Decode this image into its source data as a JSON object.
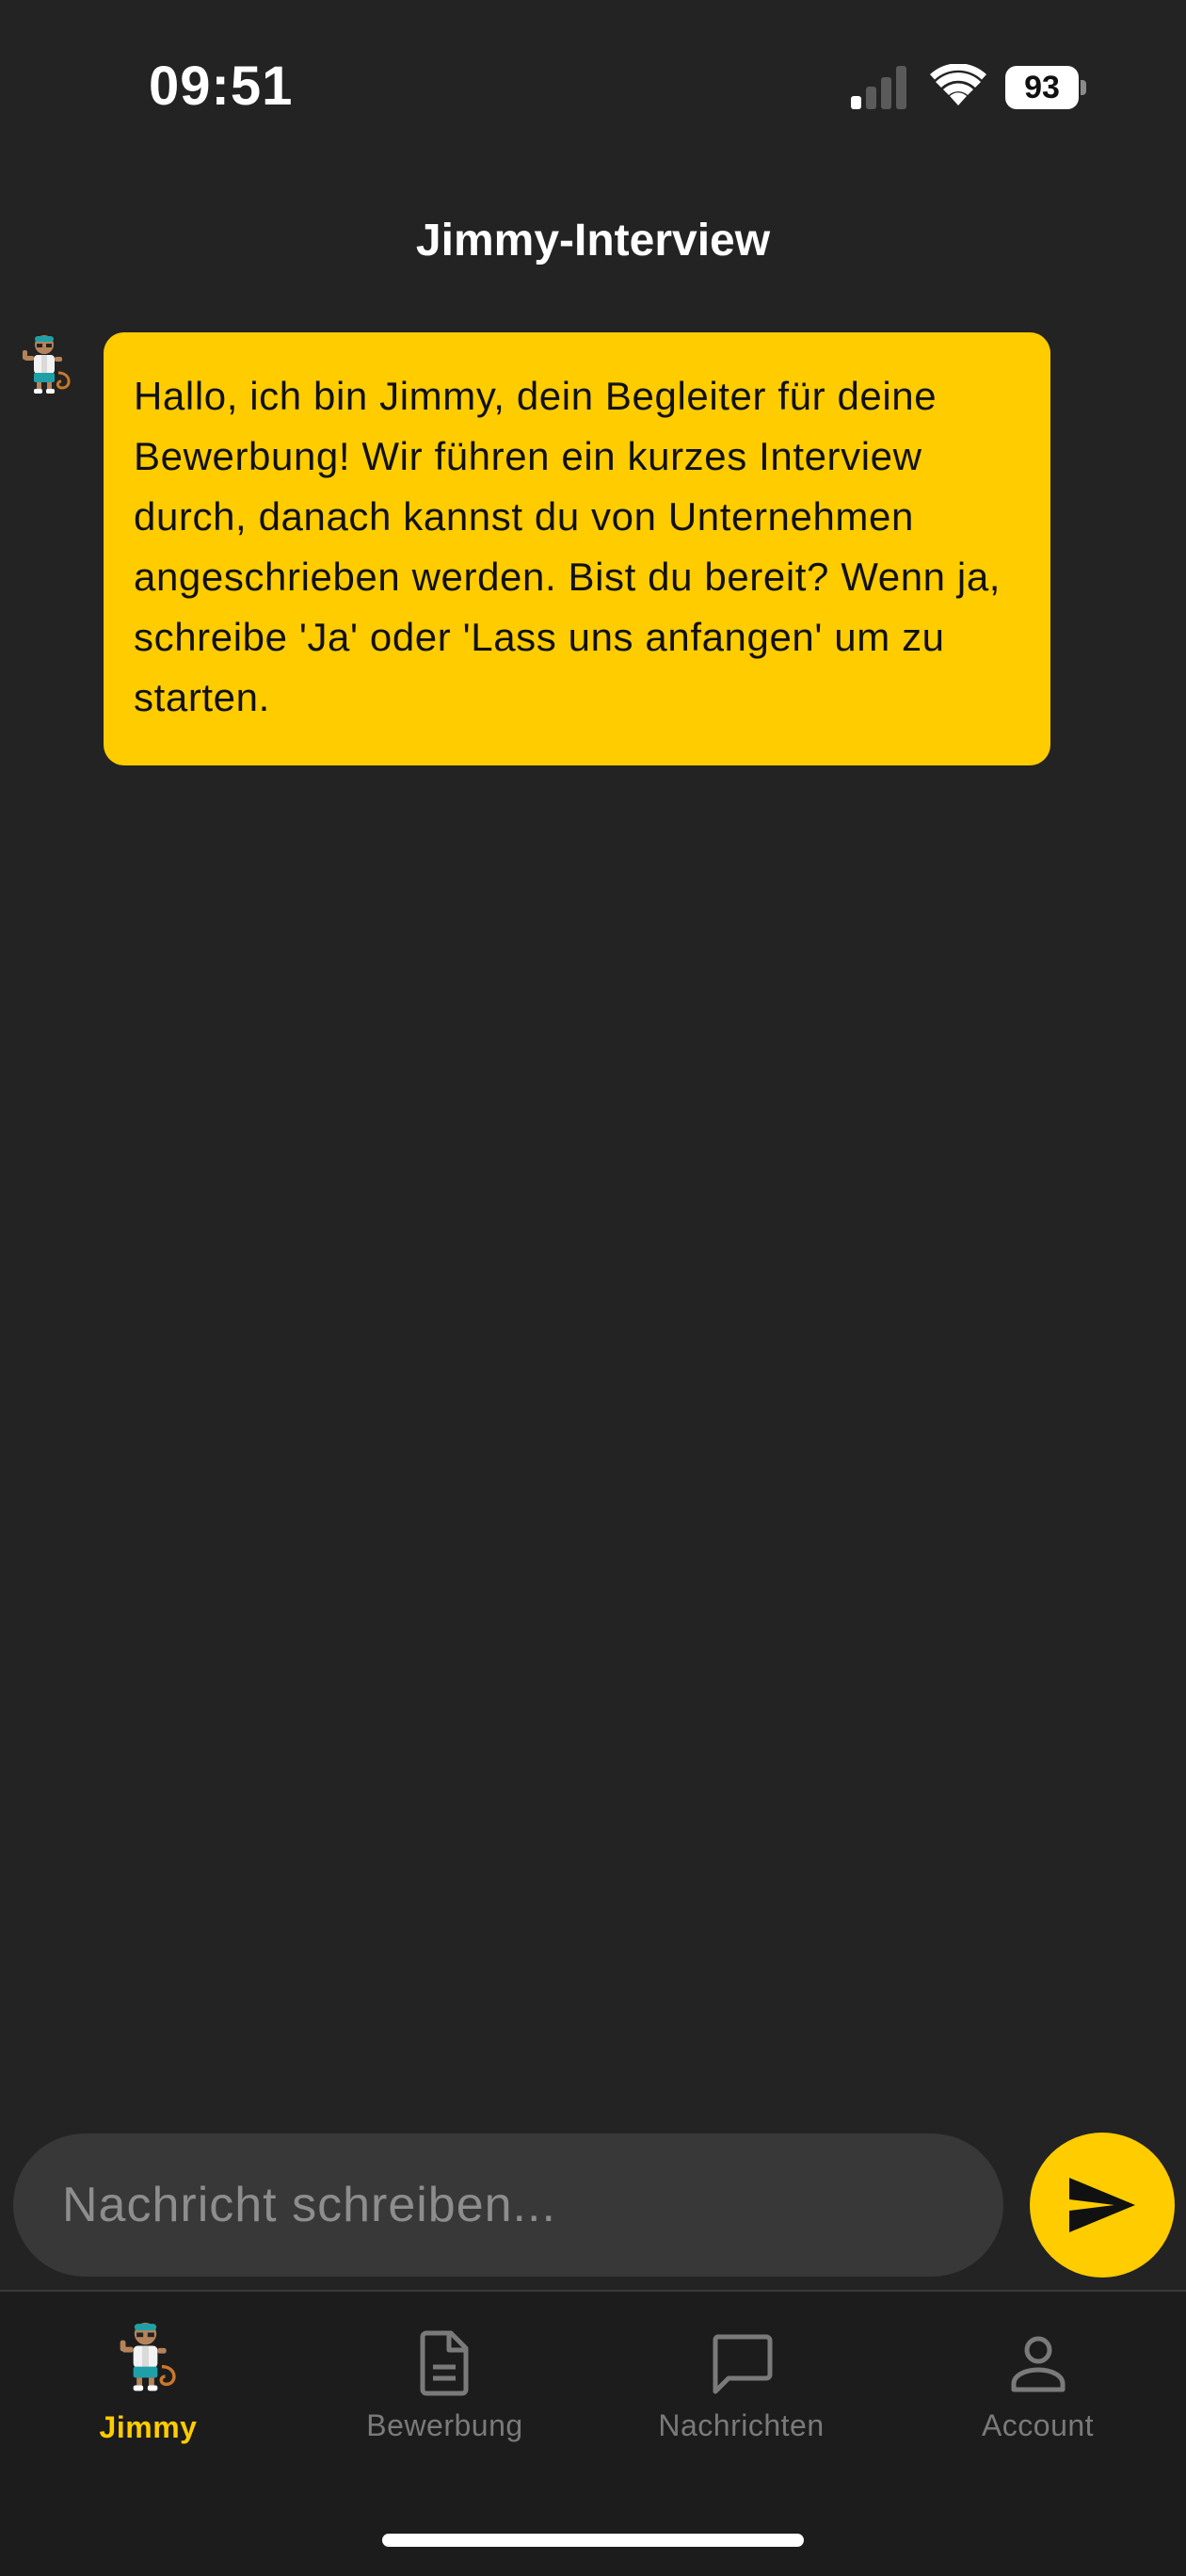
{
  "status_bar": {
    "time": "09:51",
    "battery_level": "93",
    "signal_strength_bars": 1,
    "icons": [
      "signal-icon",
      "wifi-icon",
      "battery-icon"
    ]
  },
  "header": {
    "title": "Jimmy-Interview"
  },
  "chat": {
    "messages": [
      {
        "sender_avatar": "jimmy-avatar-icon",
        "text": "Hallo, ich bin Jimmy, dein Begleiter für deine Bewerbung! Wir führen ein kurzes Interview durch, danach kannst du von Unternehmen angeschrieben werden. Bist du bereit? Wenn ja, schreibe 'Ja' oder 'Lass uns anfangen' um zu starten."
      }
    ]
  },
  "composer": {
    "placeholder": "Nachricht schreiben...",
    "value": "",
    "send_icon": "send-icon"
  },
  "bottom_nav": {
    "items": [
      {
        "label": "Jimmy",
        "icon": "jimmy-avatar-icon",
        "active": true
      },
      {
        "label": "Bewerbung",
        "icon": "document-icon",
        "active": false
      },
      {
        "label": "Nachrichten",
        "icon": "chat-bubble-icon",
        "active": false
      },
      {
        "label": "Account",
        "icon": "person-icon",
        "active": false
      }
    ]
  },
  "colors": {
    "background": "#232323",
    "accent": "#ffcc00",
    "input_background": "#383838",
    "nav_background": "#1c1c1c",
    "inactive": "#7a7a7a"
  }
}
